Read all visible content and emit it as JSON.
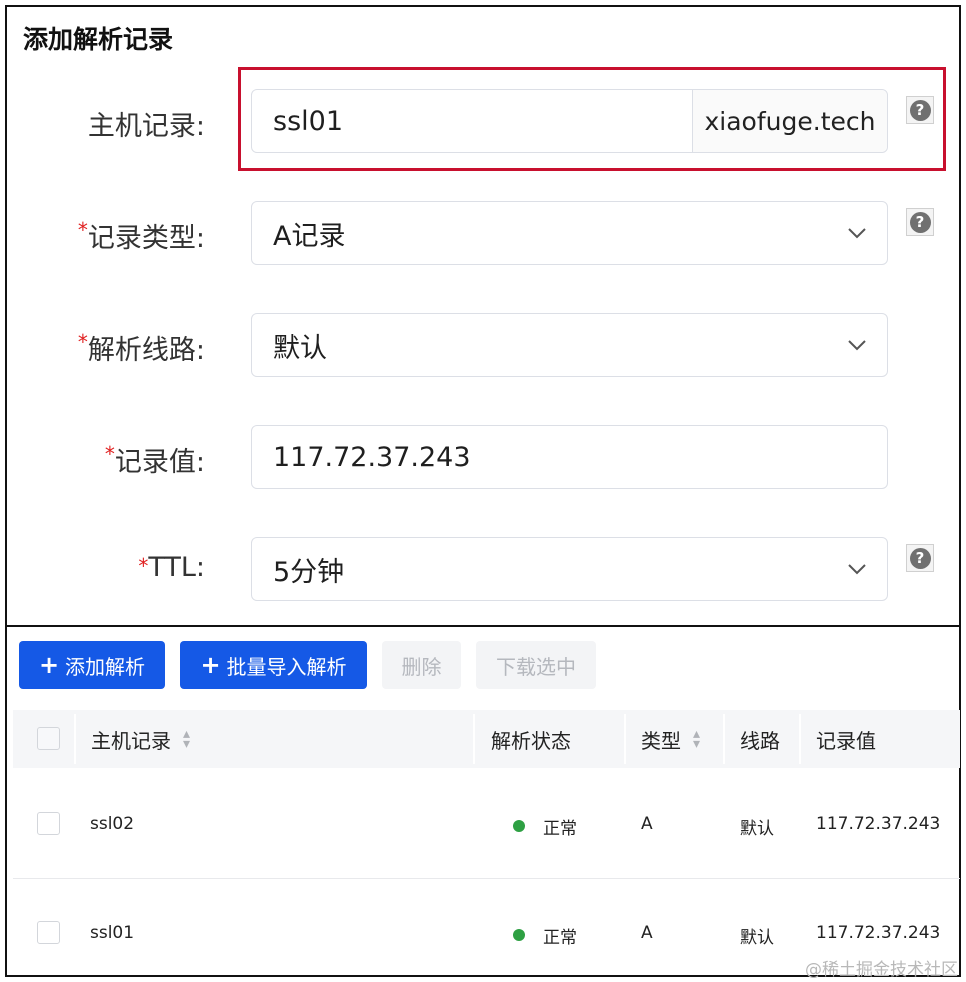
{
  "dialog": {
    "title": "添加解析记录"
  },
  "form": {
    "host_record": {
      "label": "主机记录:",
      "value": "ssl01",
      "domain_suffix": "xiaofuge.tech"
    },
    "record_type": {
      "label": "记录类型:",
      "required": "*",
      "value": "A记录"
    },
    "route": {
      "label": "解析线路:",
      "required": "*",
      "value": "默认"
    },
    "record_value": {
      "label": "记录值:",
      "required": "*",
      "value": "117.72.37.243"
    },
    "ttl": {
      "label": "TTL:",
      "required": "*",
      "value": "5分钟"
    },
    "help_icon": "?"
  },
  "toolbar": {
    "add_label": "添加解析",
    "batch_import_label": "批量导入解析",
    "delete_label": "删除",
    "download_label": "下载选中",
    "plus_icon": "+"
  },
  "table": {
    "columns": [
      "主机记录",
      "解析状态",
      "类型",
      "线路",
      "记录值"
    ],
    "rows": [
      {
        "host": "ssl02",
        "status": "正常",
        "type": "A",
        "route": "默认",
        "value": "117.72.37.243"
      },
      {
        "host": "ssl01",
        "status": "正常",
        "type": "A",
        "route": "默认",
        "value": "117.72.37.243"
      }
    ]
  },
  "watermark": "@稀土掘金技术社区",
  "colors": {
    "primary": "#1559e6",
    "highlight": "#c8102e",
    "required": "#e02020",
    "status_ok": "#2ea043"
  },
  "icons": [
    "help-icon",
    "chevron-down-icon",
    "plus-icon",
    "sort-icon",
    "checkbox",
    "status-dot"
  ]
}
